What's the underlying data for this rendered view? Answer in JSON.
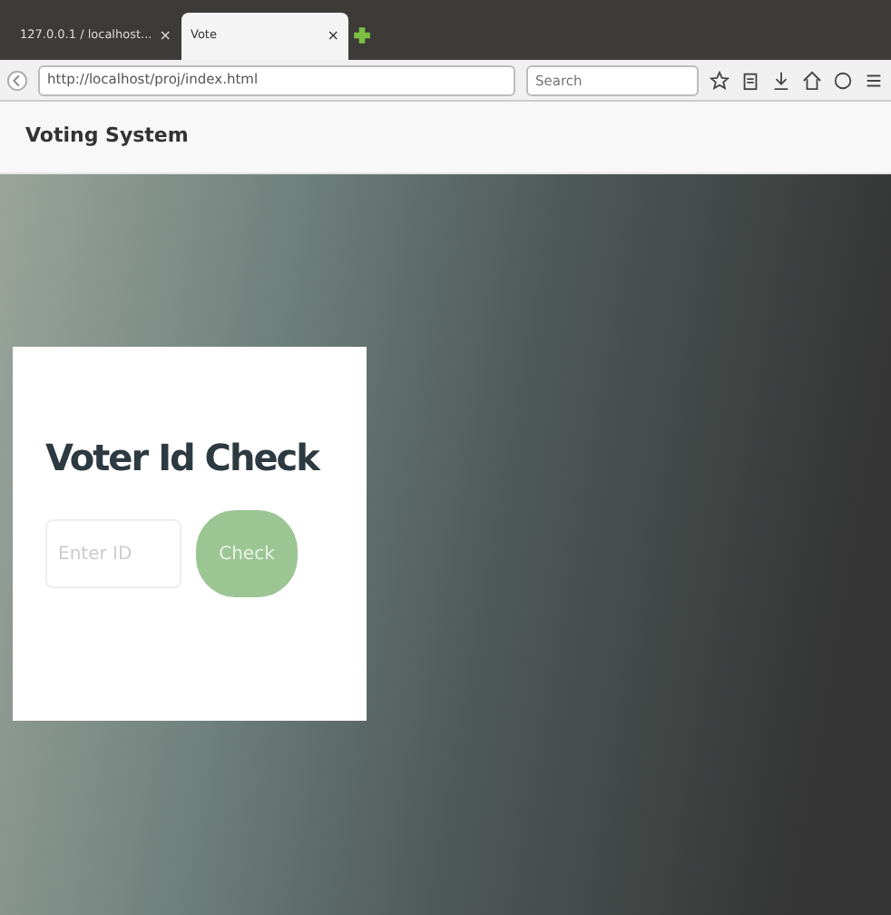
{
  "browser": {
    "tabs": [
      {
        "label": "127.0.0.1 / localhost...",
        "close": "×",
        "selected": false
      },
      {
        "label": "Vote",
        "close": "×",
        "selected": true
      }
    ],
    "address": "http://localhost/proj/index.html",
    "search": {
      "placeholder": "Search"
    }
  },
  "navbar": {
    "brand": "Voting System"
  },
  "check_card": {
    "title": "Voter Id Check",
    "field": {
      "placeholder": "Enter ID"
    },
    "button": "Check"
  }
}
